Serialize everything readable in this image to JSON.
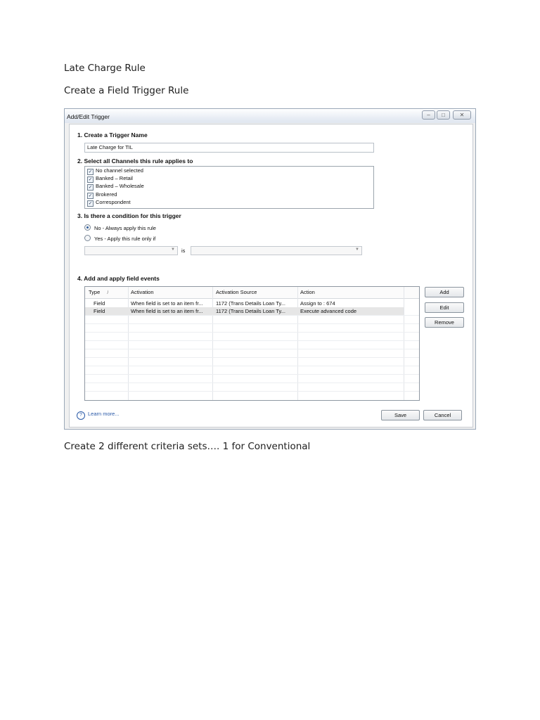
{
  "doc": {
    "heading1": "Late Charge Rule",
    "heading2": "Create a Field Trigger Rule",
    "caption": "Create 2 different criteria sets…. 1 for Conventional"
  },
  "dialog": {
    "title": "Add/Edit Trigger",
    "window_buttons": {
      "minimize": "–",
      "maximize": "□",
      "close": "✕"
    },
    "section1": {
      "title": "1. Create a Trigger Name",
      "name_value": "Late Charge for TIL"
    },
    "section2": {
      "title": "2. Select all Channels this rule applies to",
      "channels": [
        {
          "label": "No channel selected",
          "checked": true
        },
        {
          "label": "Banked – Retail",
          "checked": true
        },
        {
          "label": "Banked – Wholesale",
          "checked": true
        },
        {
          "label": "Brokered",
          "checked": true
        },
        {
          "label": "Correspondent",
          "checked": true
        }
      ]
    },
    "section3": {
      "title": "3. Is there a condition for this trigger",
      "option_no": "No - Always apply this rule",
      "option_yes": "Yes - Apply this rule only if",
      "selected": "no",
      "is_label": "is"
    },
    "section4": {
      "title": "4. Add and apply field events",
      "columns": [
        "Type",
        "Activation",
        "Activation Source",
        "Action"
      ],
      "sort_indicator": "/",
      "rows": [
        [
          "Field",
          "When field is set to an item fr...",
          "1172 (Trans Details Loan Ty...",
          "Assign to : 674"
        ],
        [
          "Field",
          "When field is set to an item fr...",
          "1172 (Trans Details Loan Ty...",
          "Execute advanced code"
        ]
      ],
      "buttons": {
        "add": "Add",
        "edit": "Edit",
        "remove": "Remove"
      }
    },
    "footer": {
      "help_icon": "?",
      "help_link": "Learn more...",
      "save": "Save",
      "cancel": "Cancel"
    }
  }
}
